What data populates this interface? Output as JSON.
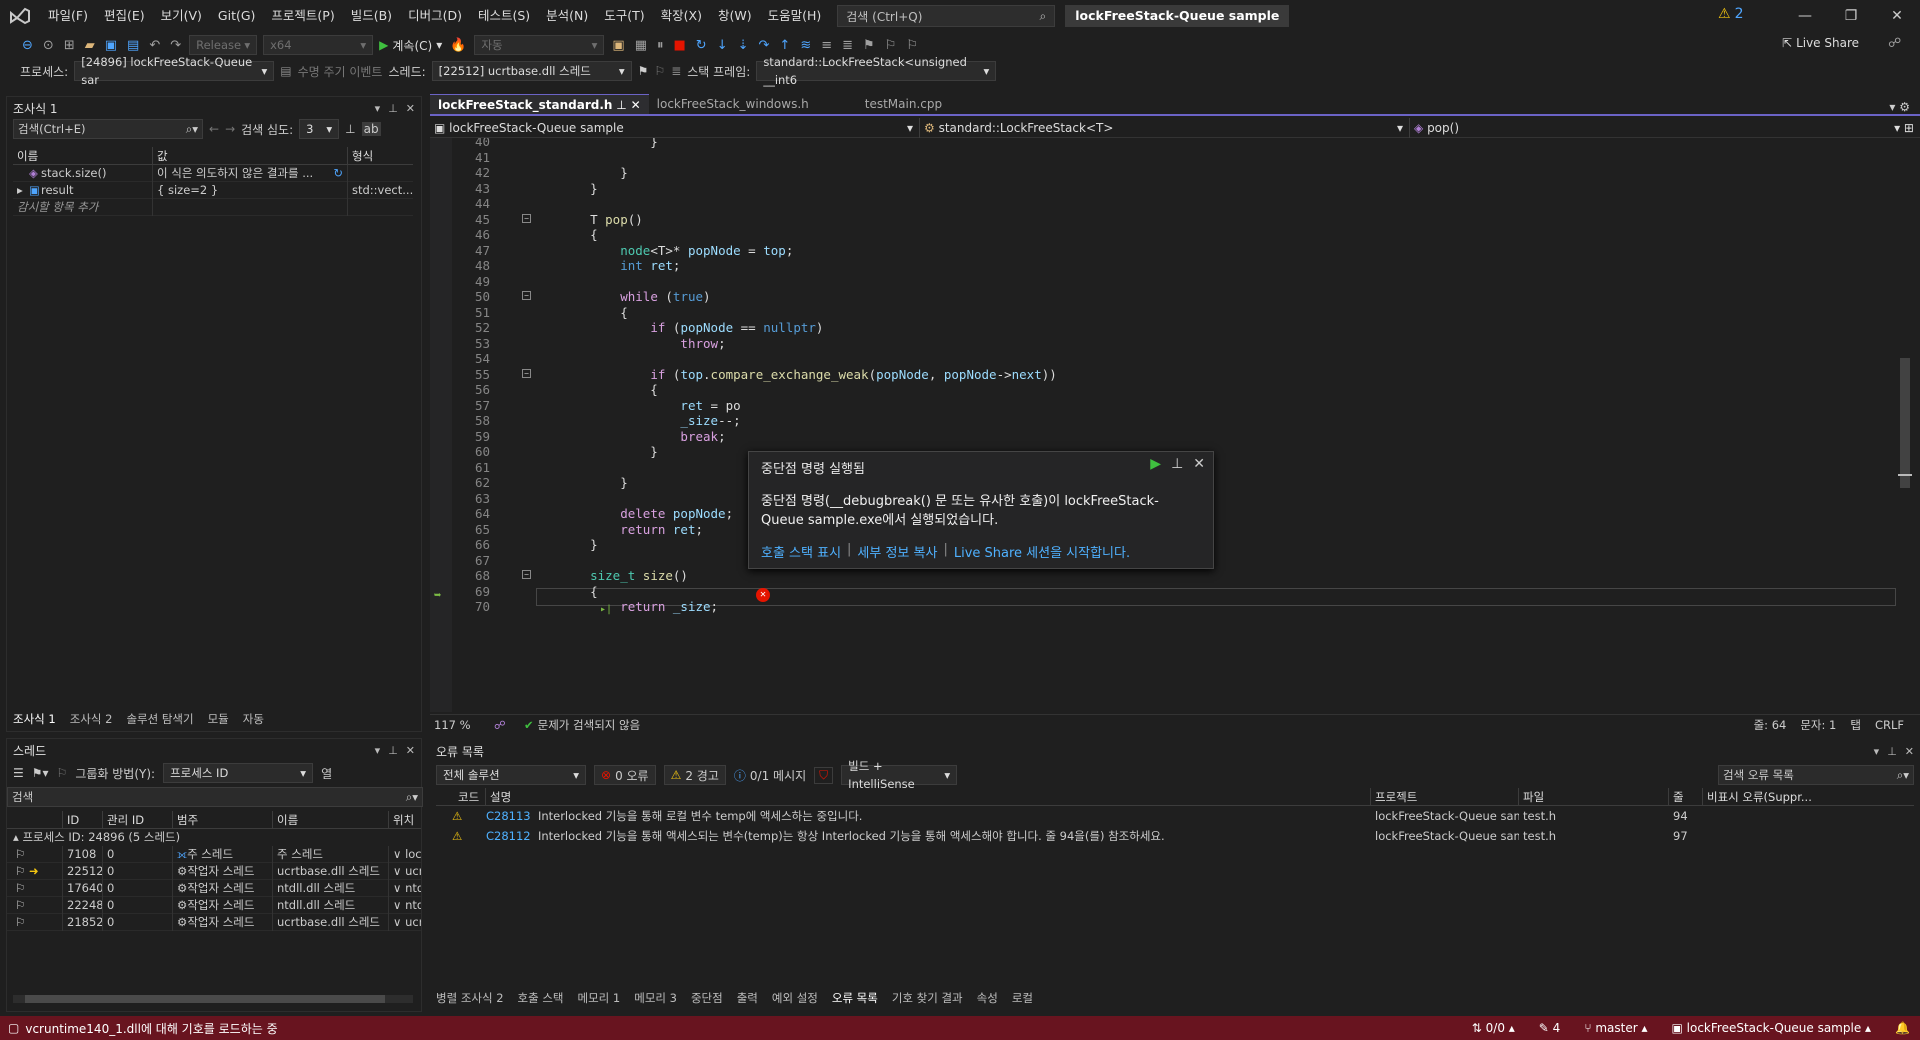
{
  "menubar": {
    "items": [
      "파일(F)",
      "편집(E)",
      "보기(V)",
      "Git(G)",
      "프로젝트(P)",
      "빌드(B)",
      "디버그(D)",
      "테스트(S)",
      "분석(N)",
      "도구(T)",
      "확장(X)",
      "창(W)",
      "도움말(H)"
    ],
    "search_placeholder": "검색 (Ctrl+Q)",
    "solution_title": "lockFreeStack-Queue sample",
    "notification_count": "2"
  },
  "toolbar": {
    "config": "Release",
    "platform": "x64",
    "continue_label": "계속(C)",
    "auto_label": "자동",
    "live_share": "Live Share"
  },
  "debugbar": {
    "process_label": "프로세스:",
    "process_value": "[24896] lockFreeStack-Queue sar",
    "lifecycle_label": "수명 주기 이벤트",
    "thread_label": "스레드:",
    "thread_value": "[22512] ucrtbase.dll 스레드",
    "stackframe_label": "스택 프레임:",
    "stackframe_value": "standard::LockFreeStack<unsigned __int6"
  },
  "watch": {
    "title": "조사식 1",
    "search_placeholder": "검색(Ctrl+E)",
    "depth_label": "검색 심도:",
    "depth_value": "3",
    "columns": [
      "이름",
      "값",
      "형식"
    ],
    "rows": [
      {
        "name": "stack.size()",
        "value": "이 식은 의도하지 않은 결과를 ...",
        "type": ""
      },
      {
        "name": "result",
        "value": "{ size=2 }",
        "type": "std::vect..."
      }
    ],
    "add_item": "감시할 항목 추가",
    "tabs": [
      "조사식 1",
      "조사식 2",
      "솔루션 탐색기",
      "모듈",
      "자동"
    ]
  },
  "threads": {
    "title": "스레드",
    "group_label": "그룹화 방법(Y):",
    "group_value": "프로세스 ID",
    "columns_label": "열",
    "search_placeholder": "검색",
    "columns": [
      "ID",
      "관리 ID",
      "범주",
      "이름",
      "위치"
    ],
    "group_row": "프로세스 ID: 24896  (5 스레드)",
    "rows": [
      {
        "id": "7108",
        "managed": "0",
        "category": "주 스레드",
        "name": "주 스레드",
        "loc": "locl"
      },
      {
        "id": "22512",
        "managed": "0",
        "category": "작업자 스레드",
        "name": "ucrtbase.dll 스레드",
        "loc": "ucr"
      },
      {
        "id": "17640",
        "managed": "0",
        "category": "작업자 스레드",
        "name": "ntdll.dll 스레드",
        "loc": "ntd"
      },
      {
        "id": "22248",
        "managed": "0",
        "category": "작업자 스레드",
        "name": "ntdll.dll 스레드",
        "loc": "ntd"
      },
      {
        "id": "21852",
        "managed": "0",
        "category": "작업자 스레드",
        "name": "ucrtbase.dll 스레드",
        "loc": "ucr"
      }
    ]
  },
  "editor": {
    "tabs": [
      "lockFreeStack_standard.h",
      "lockFreeStack_windows.h",
      "testMain.cpp"
    ],
    "nav_project": "lockFreeStack-Queue sample",
    "nav_scope": "standard::LockFreeStack<T>",
    "nav_member": "pop()",
    "zoom": "117 %",
    "issues": "문제가 검색되지 않음",
    "line_info": "줄: 64",
    "col_info": "문자: 1",
    "tab_info": "탭",
    "eol": "CRLF",
    "lines": [
      {
        "n": "40",
        "t": "            }"
      },
      {
        "n": "41",
        "t": ""
      },
      {
        "n": "42",
        "t": "        }"
      },
      {
        "n": "43",
        "t": "    }"
      },
      {
        "n": "44",
        "t": ""
      },
      {
        "n": "45",
        "t": "    T pop()"
      },
      {
        "n": "46",
        "t": "    {"
      },
      {
        "n": "47",
        "t": "        node<T>* popNode = top;"
      },
      {
        "n": "48",
        "t": "        int ret;"
      },
      {
        "n": "49",
        "t": ""
      },
      {
        "n": "50",
        "t": "        while (true)"
      },
      {
        "n": "51",
        "t": "        {"
      },
      {
        "n": "52",
        "t": "            if (popNode == nullptr)"
      },
      {
        "n": "53",
        "t": "                throw;"
      },
      {
        "n": "54",
        "t": ""
      },
      {
        "n": "55",
        "t": "            if (top.compare_exchange_weak(popNode, popNode->next))"
      },
      {
        "n": "56",
        "t": "            {"
      },
      {
        "n": "57",
        "t": "                ret = po"
      },
      {
        "n": "58",
        "t": "                _size--;"
      },
      {
        "n": "59",
        "t": "                break;"
      },
      {
        "n": "60",
        "t": "            }"
      },
      {
        "n": "61",
        "t": ""
      },
      {
        "n": "62",
        "t": "        }"
      },
      {
        "n": "63",
        "t": ""
      },
      {
        "n": "64",
        "t": "        delete popNode;"
      },
      {
        "n": "65",
        "t": "        return ret;"
      },
      {
        "n": "66",
        "t": "    }"
      },
      {
        "n": "67",
        "t": ""
      },
      {
        "n": "68",
        "t": "    size_t size()"
      },
      {
        "n": "69",
        "t": "    {"
      },
      {
        "n": "70",
        "t": "        return _size;"
      }
    ]
  },
  "popup": {
    "title": "중단점 명령 실행됨",
    "message": "중단점 명령(__debugbreak() 문 또는 유사한 호출)이 lockFreeStack-Queue sample.exe에서 실행되었습니다.",
    "link1": "호출 스택 표시",
    "link2": "세부 정보 복사",
    "link3": "Live Share 세션을 시작합니다."
  },
  "errorlist": {
    "title": "오류 목록",
    "scope": "전체 솔루션",
    "errors": "0 오류",
    "warnings": "2 경고",
    "messages": "0/1 메시지",
    "filter": "빌드 + IntelliSense",
    "search_placeholder": "검색 오류 목록",
    "columns": [
      "코드",
      "설명",
      "프로젝트",
      "파일",
      "줄",
      "비표시 오류(Suppr..."
    ],
    "rows": [
      {
        "code": "C28113",
        "desc": "Interlocked 기능을 통해 로컬 변수 temp에 액세스하는 중입니다.",
        "project": "lockFreeStack-Queue sam...",
        "file": "test.h",
        "line": "94"
      },
      {
        "code": "C28112",
        "desc": "Interlocked 기능을 통해 액세스되는 변수(temp)는 항상 Interlocked 기능을 통해 액세스해야 합니다. 줄 94을(를) 참조하세요.",
        "project": "lockFreeStack-Queue sam...",
        "file": "test.h",
        "line": "97"
      }
    ],
    "tabs": [
      "병렬 조사식 2",
      "호출 스택",
      "메모리 1",
      "메모리 3",
      "중단점",
      "출력",
      "예외 설정",
      "오류 목록",
      "기호 찾기 결과",
      "속성",
      "로컬"
    ]
  },
  "status": {
    "message": "vcruntime140_1.dll에 대해 기호를 로드하는 중",
    "changes": "0/0",
    "edits": "4",
    "branch": "master",
    "solution": "lockFreeStack-Queue sample"
  },
  "colors": {
    "accent": "#6b63c6",
    "status": "#68141f",
    "link": "#4fb1ff"
  }
}
